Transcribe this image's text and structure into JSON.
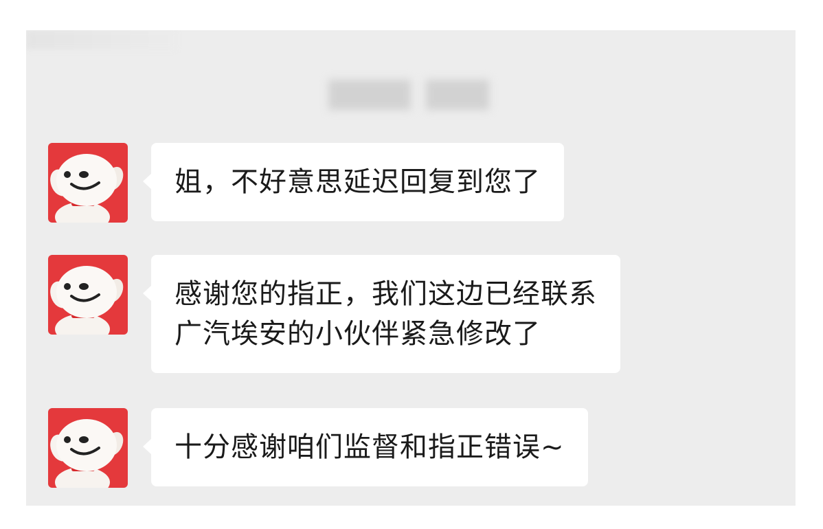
{
  "header": {
    "time_label": ""
  },
  "messages": [
    {
      "text": "姐，不好意思延迟回复到您了",
      "avatar_icon": "jd-joy-dog-avatar-icon"
    },
    {
      "text": "感谢您的指正，我们这边已经联系\n广汽埃安的小伙伴紧急修改了",
      "avatar_icon": "jd-joy-dog-avatar-icon"
    },
    {
      "text": "十分感谢咱们监督和指正错误~",
      "avatar_icon": "jd-joy-dog-avatar-icon"
    }
  ],
  "colors": {
    "panel_background": "#ededed",
    "bubble_background": "#ffffff",
    "avatar_background": "#e4393c",
    "text": "#1a1a1a"
  }
}
